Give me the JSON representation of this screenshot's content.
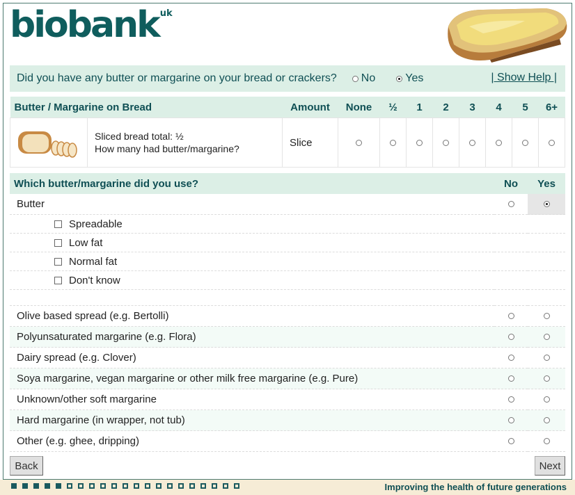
{
  "brand": {
    "name": "biobank",
    "suffix": "uk"
  },
  "question": {
    "text": "Did you have any butter or margarine on your bread or crackers?",
    "no_label": "No",
    "yes_label": "Yes",
    "selected": "Yes",
    "help_label": "| Show Help |"
  },
  "amount_table": {
    "headers": [
      "Butter / Margarine on Bread",
      "Amount",
      "None",
      "½",
      "1",
      "2",
      "3",
      "4",
      "5",
      "6+"
    ],
    "row": {
      "desc_line1": "Sliced bread total: ½",
      "desc_line2": "How many had butter/margarine?",
      "unit": "Slice",
      "selected": null
    }
  },
  "which_table": {
    "header": "Which butter/margarine did you use?",
    "col_no": "No",
    "col_yes": "Yes",
    "butter": {
      "label": "Butter",
      "selected": "Yes"
    },
    "butter_types": [
      "Spreadable",
      "Low fat",
      "Normal fat",
      "Don't know"
    ],
    "options": [
      "Olive based spread (e.g. Bertolli)",
      "Polyunsaturated margarine (e.g. Flora)",
      "Dairy spread (e.g. Clover)",
      "Soya margarine, vegan margarine or other milk free margarine (e.g. Pure)",
      "Unknown/other soft margarine",
      "Hard margarine (in wrapper, not tub)",
      "Other (e.g. ghee, dripping)"
    ]
  },
  "nav": {
    "back_label": "Back",
    "next_label": "Next"
  },
  "footer": {
    "tagline": "Improving the health of future generations",
    "progress_done": 5,
    "progress_total": 21
  },
  "colors": {
    "brand": "#0f5d5d",
    "header_bg": "#dcefe6",
    "footer_bg": "#f6ecd6"
  }
}
